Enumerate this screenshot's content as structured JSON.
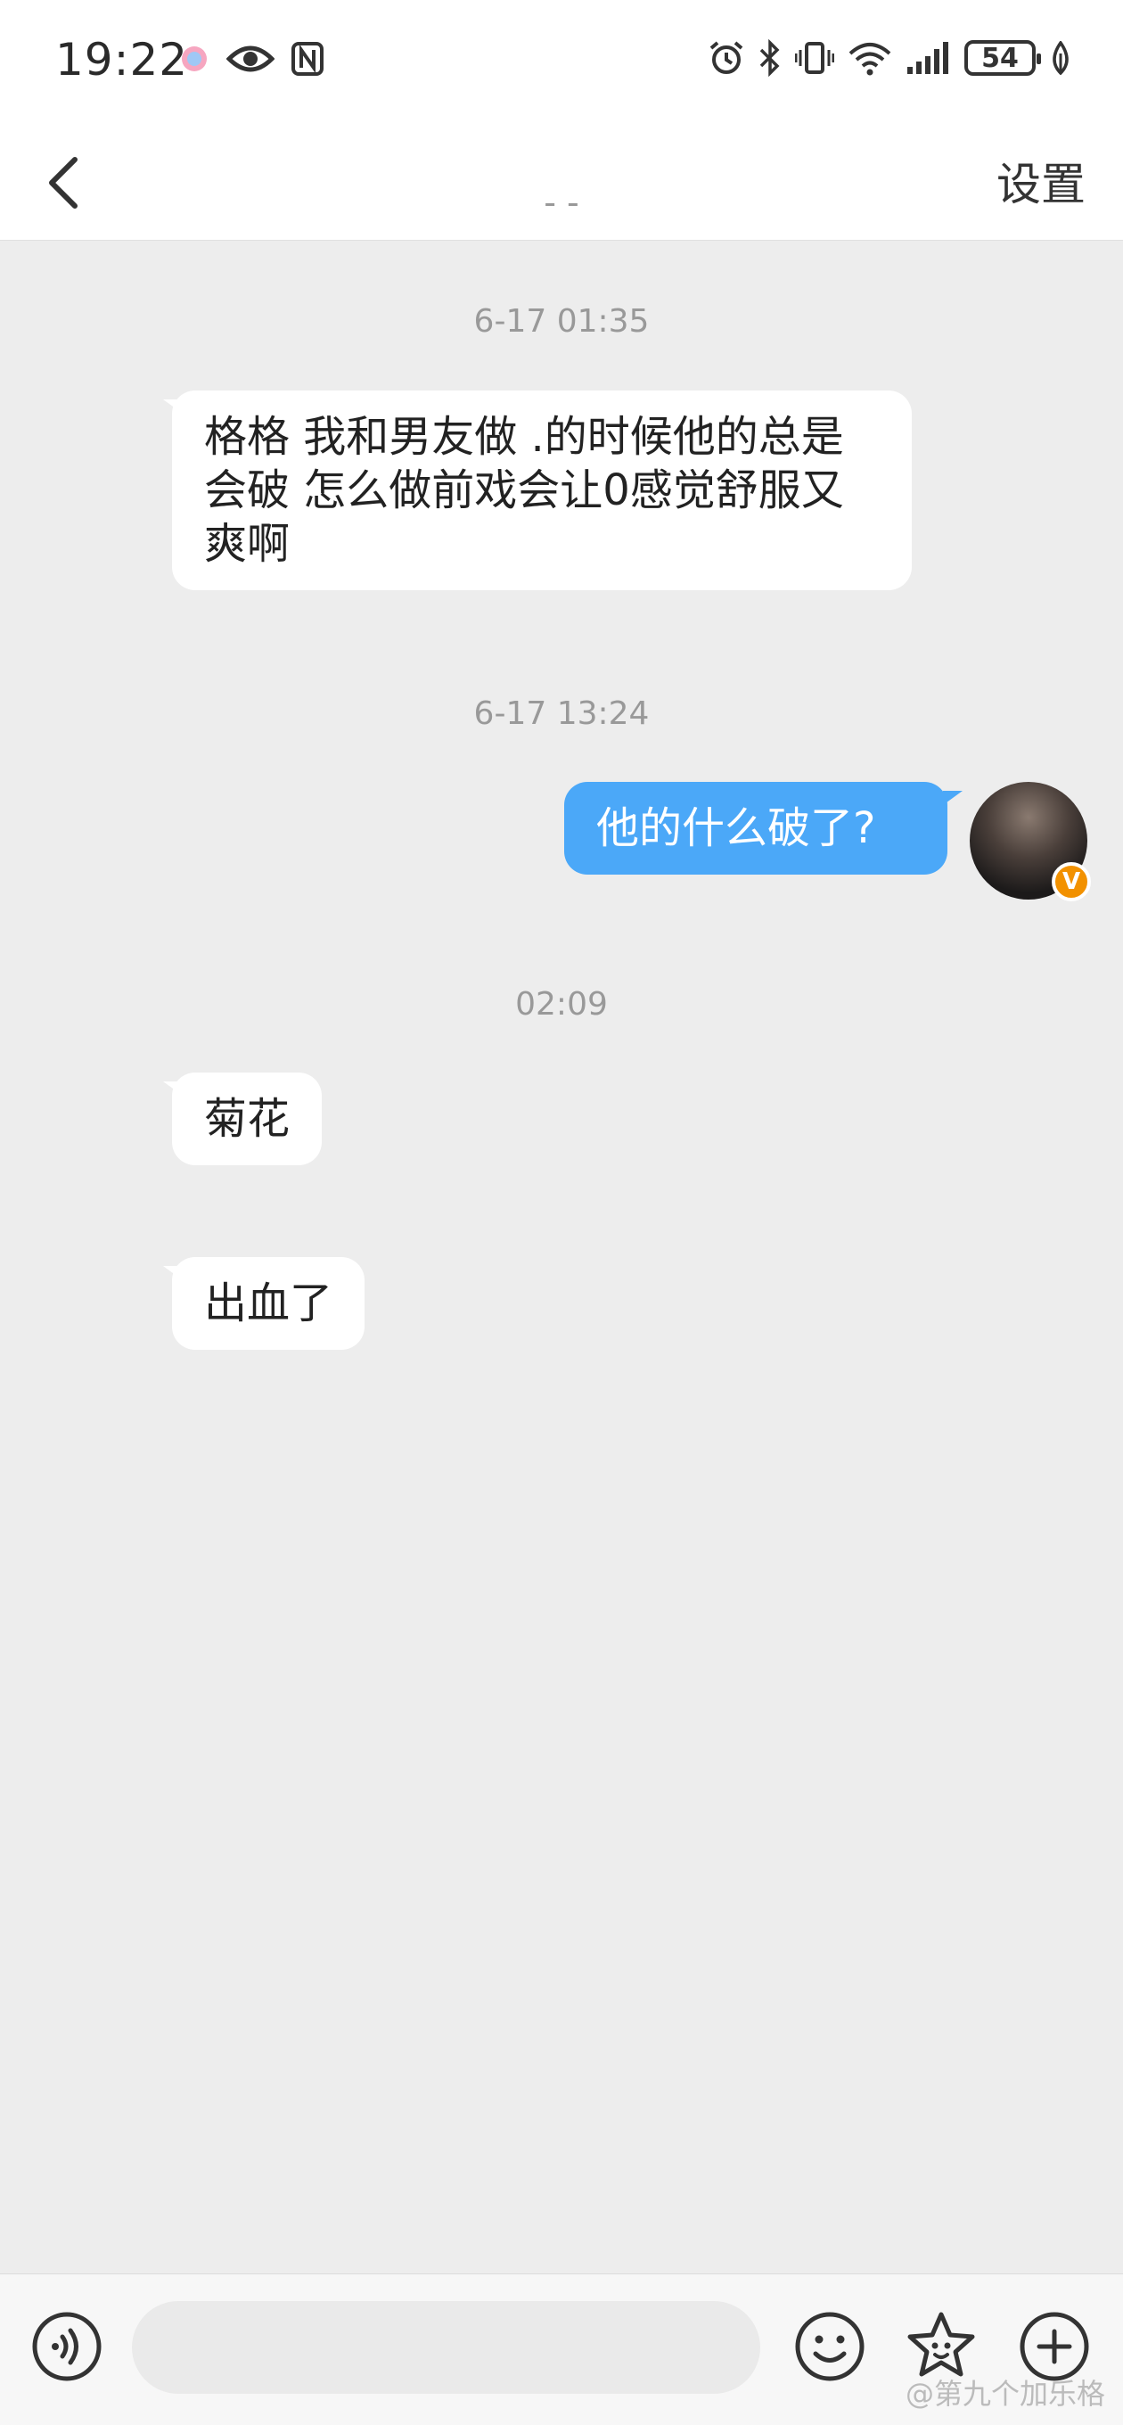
{
  "status_bar": {
    "time": "19:22",
    "battery": "54",
    "icons": [
      "color-dot-icon",
      "eye-icon",
      "nfc-icon",
      "alarm-icon",
      "bluetooth-icon",
      "vibrate-icon",
      "wifi-icon",
      "signal-icon",
      "battery-icon",
      "leaf-icon"
    ]
  },
  "nav": {
    "title": "- -",
    "settings_label": "设置"
  },
  "messages": [
    {
      "timestamp": "6-17 01:35"
    },
    {
      "from": "other",
      "text": "格格 我和男友做   .的时候他的总是会破 怎么做前戏会让0感觉舒服又爽啊"
    },
    {
      "timestamp": "6-17 13:24"
    },
    {
      "from": "me",
      "text": "他的什么破了?"
    },
    {
      "timestamp": "02:09"
    },
    {
      "from": "other",
      "text": "菊花"
    },
    {
      "from": "other",
      "text": "出血了"
    }
  ],
  "avatar": {
    "badge": "V"
  },
  "input": {
    "placeholder": ""
  },
  "watermark": "@第九个加乐格",
  "colors": {
    "accent": "#4ba8f8",
    "badge": "#f29100",
    "background": "#ededed"
  }
}
